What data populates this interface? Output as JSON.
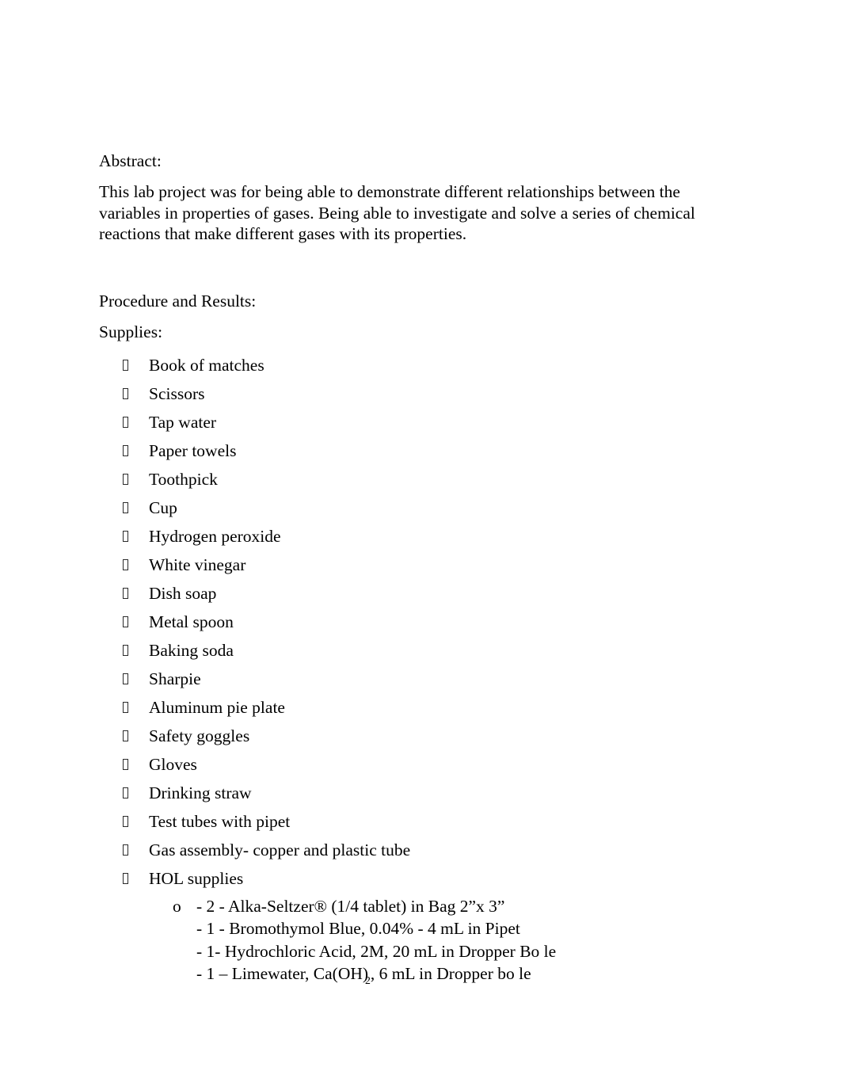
{
  "document": {
    "sections": {
      "abstract": {
        "heading": "Abstract:",
        "body": "This lab project was for being able to demonstrate different relationships between the variables in properties of gases. Being able to investigate and solve a series of chemical reactions that make different gases with its properties."
      },
      "procedure": {
        "heading": "Procedure and Results:",
        "supplies_heading": "Supplies:",
        "bullet_glyph": "tofu-box",
        "sub_bullet_glyph": "o",
        "supplies": [
          "Book of matches",
          "Scissors",
          "Tap water",
          "Paper towels",
          "Toothpick",
          "Cup",
          "Hydrogen peroxide",
          "White vinegar",
          "Dish soap",
          "Metal spoon",
          "Baking soda",
          "Sharpie",
          "Aluminum pie plate",
          "Safety goggles",
          "Gloves",
          "Drinking straw",
          "Test tubes with pipet",
          "Gas assembly- copper and plastic tube",
          "HOL supplies"
        ],
        "hol_reagents": [
          "- 2 - Alka-Seltzer® (1/4 tablet) in Bag 2”x 3”",
          "- 1 - Bromothymol Blue, 0.04% - 4 mL in Pipet",
          "- 1- Hydrochloric Acid, 2M, 20 mL in Dropper Bo le"
        ],
        "hol_reagent_limewater": {
          "prefix": "- 1 – Limewater, Ca(OH)",
          "subscript": "2",
          "suffix": ", 6 mL in Dropper bo le"
        }
      }
    },
    "colors": {
      "page_background": "#ffffff",
      "text": "#000000"
    }
  }
}
